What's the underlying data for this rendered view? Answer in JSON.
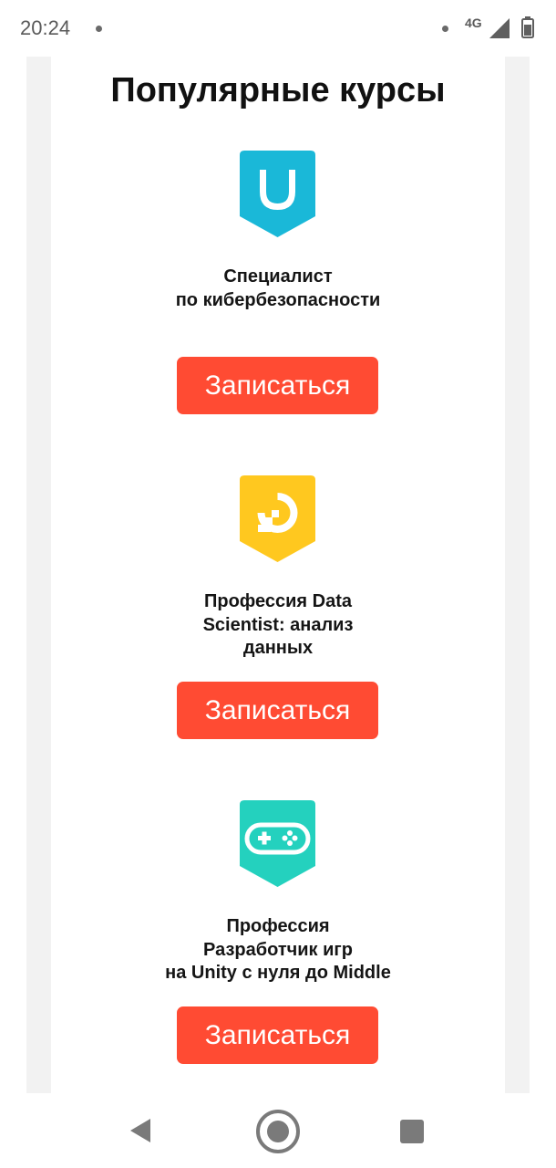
{
  "status_bar": {
    "time": "20:24",
    "network": "4G",
    "icons": [
      "notification-dot-icon",
      "signal-icon",
      "battery-icon"
    ]
  },
  "section": {
    "title": "Популярные курсы"
  },
  "courses": [
    {
      "name_lines": [
        "Специалист",
        "по кибербезопасности"
      ],
      "icon": "shield-badge-icon",
      "badge_color": "#1ab8d8",
      "button_label": "Записаться"
    },
    {
      "name_lines": [
        "Профессия Data",
        "Scientist: анализ",
        "данных"
      ],
      "icon": "data-pixel-badge-icon",
      "badge_color": "#ffc81f",
      "button_label": "Записаться"
    },
    {
      "name_lines": [
        "Профессия",
        "Разработчик игр",
        "на Unity с нуля до Middle"
      ],
      "icon": "gamepad-badge-icon",
      "badge_color": "#24d1be",
      "button_label": "Записаться"
    }
  ],
  "colors": {
    "button": "#ff4b33",
    "gutter": "#f2f2f2"
  },
  "nav_bar": {
    "icons": [
      "back-icon",
      "home-icon",
      "recents-icon"
    ]
  }
}
